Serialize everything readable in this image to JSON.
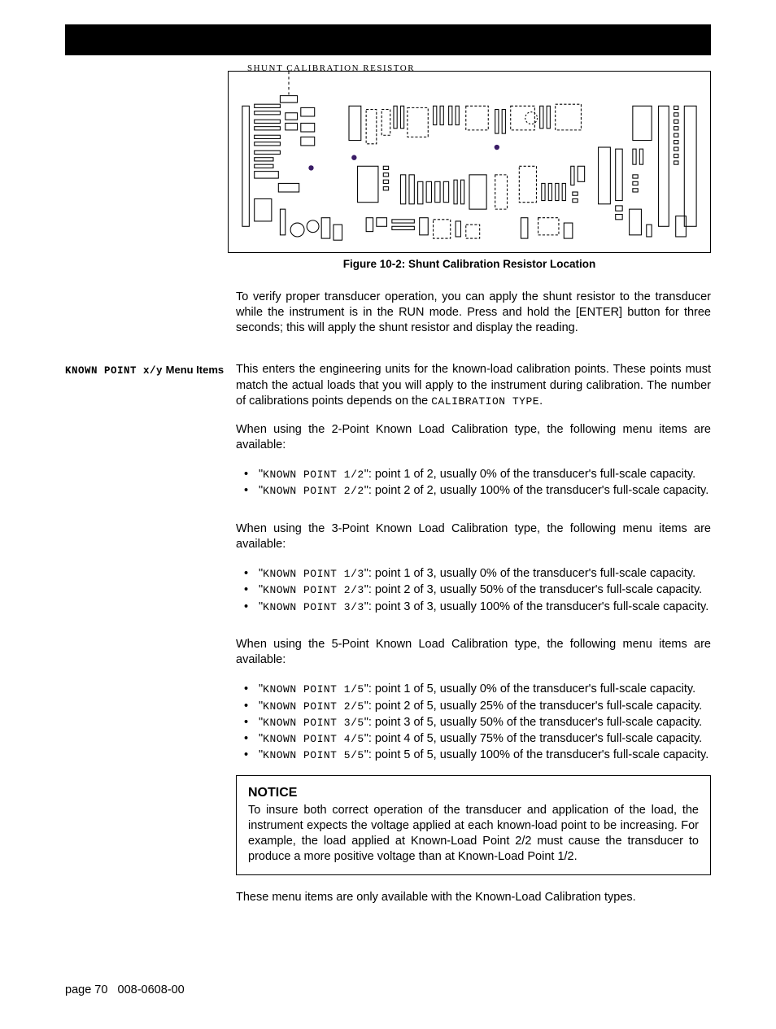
{
  "figure": {
    "schematic_label": "SHUNT CALIBRATION RESISTOR",
    "caption": "Figure 10-2: Shunt Calibration Resistor Location"
  },
  "para_verify": "To verify proper transducer operation, you can apply the shunt resistor to the transducer while the instrument is in the RUN mode.  Press and hold the [ENTER] button for three seconds; this will apply the shunt resistor and display the reading.",
  "sidehead": {
    "lcd": "KNOWN POINT x/y",
    "rest": " Menu Items"
  },
  "para_intro1": "This enters the engineering units for the known-load calibration points.  These points must match the actual loads that you will apply to the instrument during calibration.  The number of calibrations points depends on the ",
  "caltype": "CALIBRATION TYPE",
  "para_intro2": ".",
  "section2": {
    "lead": "When using the 2-Point Known Load Calibration type, the following menu items are available:",
    "items": [
      {
        "code": "KNOWN POINT 1/2",
        "desc": ": point 1 of 2, usually 0% of the transducer's full-scale capacity."
      },
      {
        "code": "KNOWN POINT 2/2",
        "desc": ": point 2 of 2, usually 100% of the transducer's full-scale capacity."
      }
    ]
  },
  "section3": {
    "lead": "When using the 3-Point Known Load Calibration type, the following menu items are available:",
    "items": [
      {
        "code": "KNOWN POINT 1/3",
        "desc": ": point 1 of 3, usually 0% of the transducer's full-scale capacity."
      },
      {
        "code": "KNOWN POINT 2/3",
        "desc": ": point 2 of 3, usually 50% of the transducer's full-scale capacity."
      },
      {
        "code": "KNOWN POINT 3/3",
        "desc": ": point 3 of 3, usually 100% of the transducer's full-scale capacity."
      }
    ]
  },
  "section5": {
    "lead": "When using the 5-Point Known Load Calibration type, the following menu items are available:",
    "items": [
      {
        "code": "KNOWN POINT 1/5",
        "desc": ": point 1 of 5, usually 0% of the transducer's full-scale capacity."
      },
      {
        "code": "KNOWN POINT 2/5",
        "desc": ": point 2 of 5, usually 25% of the transducer's full-scale capacity."
      },
      {
        "code": "KNOWN POINT 3/5",
        "desc": ": point 3 of 5, usually 50% of the transducer's full-scale capacity."
      },
      {
        "code": "KNOWN POINT 4/5",
        "desc": ": point 4 of 5, usually 75% of the transducer's full-scale capacity."
      },
      {
        "code": "KNOWN POINT 5/5",
        "desc": ": point 5 of 5, usually 100% of the transducer's full-scale capacity."
      }
    ]
  },
  "notice": {
    "title": "NOTICE",
    "text": "To insure both correct operation of the transducer and application of the load, the instrument expects the voltage applied at each known-load point to be increasing.  For example, the load applied at Known-Load Point 2/2 must cause the transducer to produce a more positive voltage than at Known-Load Point 1/2."
  },
  "closing": "These menu items are only available with the Known-Load Calibration types.",
  "footer": {
    "page": "page 70",
    "doc": "008-0608-00"
  }
}
